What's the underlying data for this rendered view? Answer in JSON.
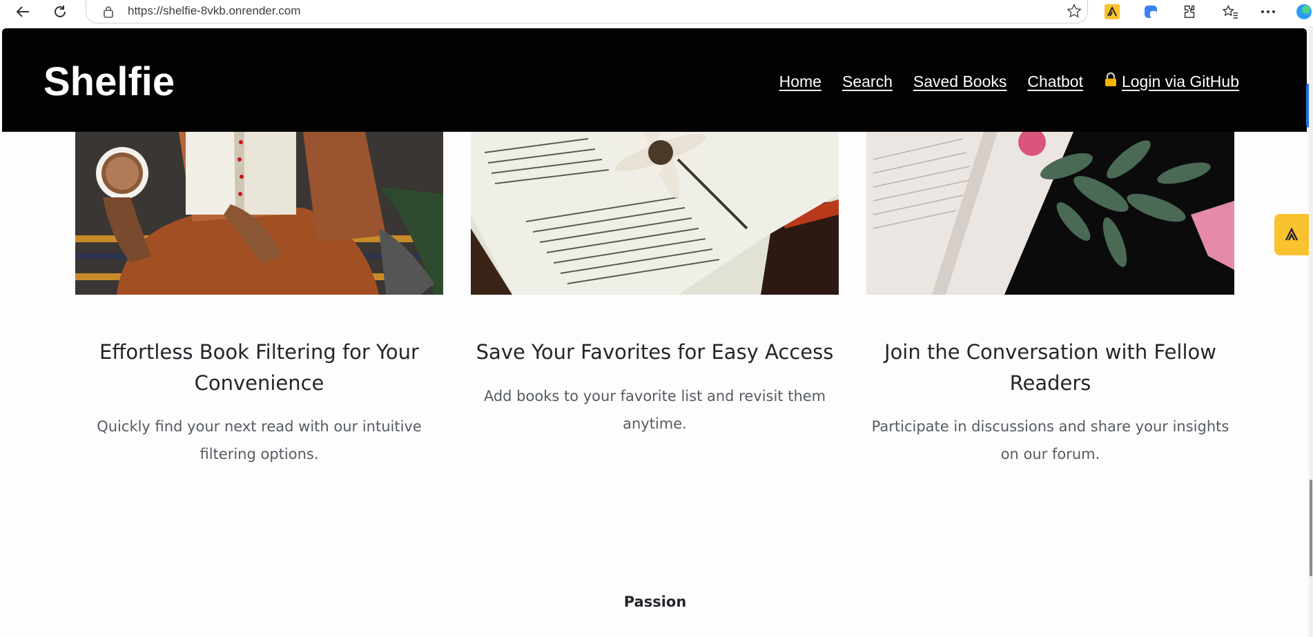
{
  "browser": {
    "url": "https://shelfie-8vkb.onrender.com"
  },
  "site": {
    "brand": "Shelfie",
    "nav": [
      {
        "label": "Home"
      },
      {
        "label": "Search"
      },
      {
        "label": "Saved Books"
      },
      {
        "label": "Chatbot"
      },
      {
        "label": "Login via GitHub",
        "icon": "lock-icon"
      }
    ]
  },
  "features": [
    {
      "title": "Effortless Book Filtering for Your Convenience",
      "text": "Quickly find your next read with our intuitive filtering options."
    },
    {
      "title": "Save Your Favorites for Easy Access",
      "text": "Add books to your favorite list and revisit them anytime."
    },
    {
      "title": "Join the Conversation with Fellow Readers",
      "text": "Participate in discussions and share your insights on our forum."
    }
  ],
  "section_label": "Passion",
  "colors": {
    "header_bg": "#020202",
    "accent_widget": "#f9c22e"
  }
}
